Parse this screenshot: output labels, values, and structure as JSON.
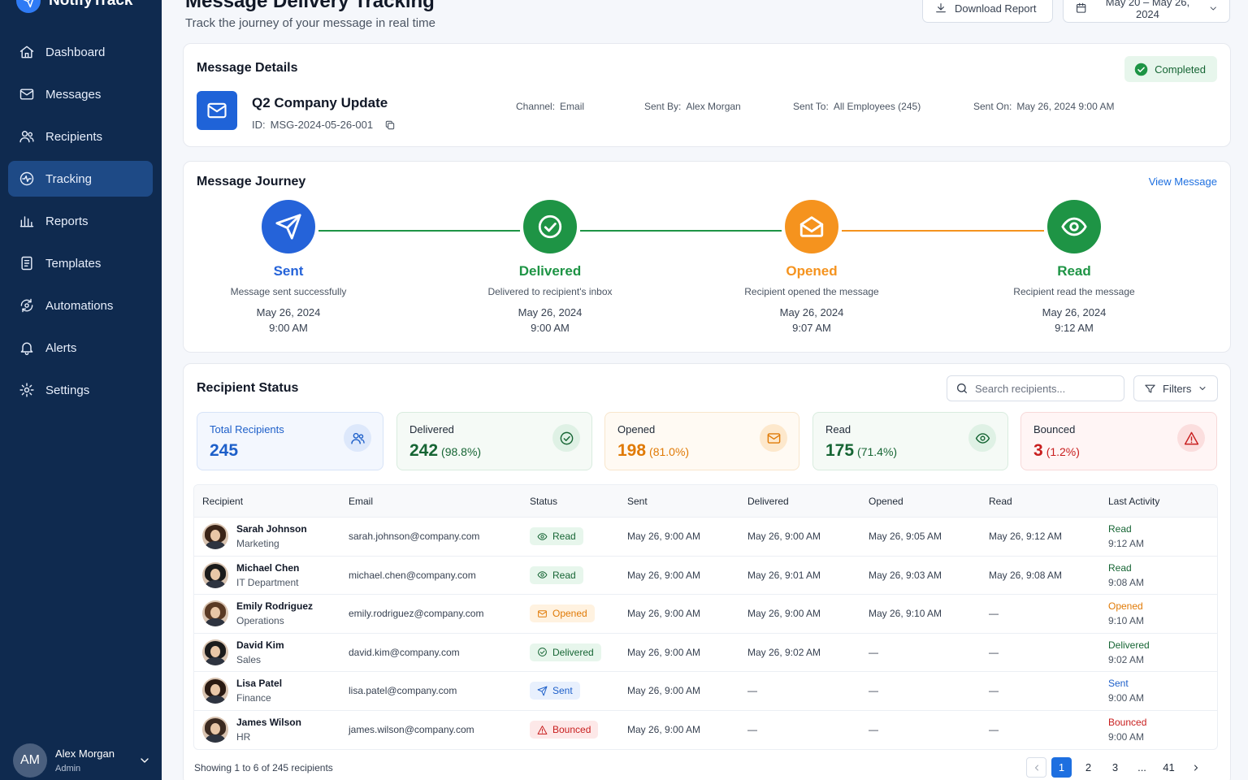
{
  "app": {
    "name": "NotifyTrack"
  },
  "nav": [
    {
      "label": "Dashboard",
      "icon": "home-icon"
    },
    {
      "label": "Messages",
      "icon": "mail-icon"
    },
    {
      "label": "Recipients",
      "icon": "users-icon"
    },
    {
      "label": "Tracking",
      "icon": "activity-icon",
      "active": true
    },
    {
      "label": "Reports",
      "icon": "bar-chart-icon"
    },
    {
      "label": "Templates",
      "icon": "document-icon"
    },
    {
      "label": "Automations",
      "icon": "automation-icon"
    },
    {
      "label": "Alerts",
      "icon": "bell-icon"
    },
    {
      "label": "Settings",
      "icon": "gear-icon"
    }
  ],
  "user": {
    "initials": "AM",
    "name": "Alex Morgan",
    "role": "Admin"
  },
  "header": {
    "title": "Message Delivery Tracking",
    "subtitle": "Track the journey of your message in real time",
    "download_label": "Download Report",
    "date_range": "May 20 – May 26, 2024"
  },
  "details": {
    "title": "Message Details",
    "status": "Completed",
    "message_name": "Q2 Company Update",
    "id_label": "ID:",
    "id_value": "MSG-2024-05-26-001",
    "channel_label": "Channel:",
    "channel_value": "Email",
    "sent_by_label": "Sent By:",
    "sent_by_value": "Alex Morgan",
    "sent_to_label": "Sent To:",
    "sent_to_value": "All Employees (245)",
    "sent_on_label": "Sent On:",
    "sent_on_value": "May 26, 2024 9:00 AM"
  },
  "journey": {
    "title": "Message Journey",
    "view_label": "View Message",
    "steps": [
      {
        "name": "Sent",
        "desc": "Message sent successfully",
        "date": "May 26, 2024",
        "time": "9:00 AM",
        "color": "#2563d9",
        "icon": "send-icon"
      },
      {
        "name": "Delivered",
        "desc": "Delivered to recipient's inbox",
        "date": "May 26, 2024",
        "time": "9:00 AM",
        "color": "#1e9445",
        "icon": "check-circle-icon"
      },
      {
        "name": "Opened",
        "desc": "Recipient opened the message",
        "date": "May 26, 2024",
        "time": "9:07 AM",
        "color": "#f5931e",
        "icon": "mail-open-icon"
      },
      {
        "name": "Read",
        "desc": "Recipient read the message",
        "date": "May 26, 2024",
        "time": "9:12 AM",
        "color": "#1e9445",
        "icon": "eye-icon"
      }
    ],
    "connector_colors": [
      "#1e9445",
      "#1e9445",
      "#f5931e"
    ]
  },
  "status": {
    "title": "Recipient Status",
    "search_placeholder": "Search recipients...",
    "filters_label": "Filters",
    "stats": [
      {
        "label": "Total Recipients",
        "value": "245",
        "pct": "",
        "icon": "users-icon",
        "fg": "#1d5fc9",
        "bg": "#f3f7fe",
        "border": "#d7e3f7",
        "icbg": "#dde8fb"
      },
      {
        "label": "Delivered",
        "value": "242",
        "pct": "(98.8%)",
        "icon": "check-circle-icon",
        "fg": "#166534",
        "bg": "#f5faf6",
        "border": "#d9ecdf",
        "icbg": "#dff1e5"
      },
      {
        "label": "Opened",
        "value": "198",
        "pct": "(81.0%)",
        "icon": "mail-icon",
        "fg": "#e07a06",
        "bg": "#fffaf3",
        "border": "#f8e6cc",
        "icbg": "#fde8cc"
      },
      {
        "label": "Read",
        "value": "175",
        "pct": "(71.4%)",
        "icon": "eye-icon",
        "fg": "#166534",
        "bg": "#f5faf6",
        "border": "#d9ecdf",
        "icbg": "#dff1e5"
      },
      {
        "label": "Bounced",
        "value": "3",
        "pct": "(1.2%)",
        "icon": "alert-triangle-icon",
        "fg": "#c81e1e",
        "bg": "#fff5f5",
        "border": "#f7d9d9",
        "icbg": "#fbdede"
      }
    ],
    "columns": [
      "Recipient",
      "Email",
      "Status",
      "Sent",
      "Delivered",
      "Opened",
      "Read",
      "Last Activity"
    ],
    "rows": [
      {
        "name": "Sarah Johnson",
        "dept": "Marketing",
        "email": "sarah.johnson@company.com",
        "status": "Read",
        "sent": "May 26, 9:00 AM",
        "delivered": "May 26, 9:00 AM",
        "opened": "May 26, 9:05 AM",
        "read": "May 26, 9:12 AM",
        "last": "Read",
        "last_time": "9:12 AM",
        "hair": "#3a2418"
      },
      {
        "name": "Michael Chen",
        "dept": "IT Department",
        "email": "michael.chen@company.com",
        "status": "Read",
        "sent": "May 26, 9:00 AM",
        "delivered": "May 26, 9:01 AM",
        "opened": "May 26, 9:03 AM",
        "read": "May 26, 9:08 AM",
        "last": "Read",
        "last_time": "9:08 AM",
        "hair": "#1b1b1b"
      },
      {
        "name": "Emily Rodriguez",
        "dept": "Operations",
        "email": "emily.rodriguez@company.com",
        "status": "Opened",
        "sent": "May 26, 9:00 AM",
        "delivered": "May 26, 9:00 AM",
        "opened": "May 26, 9:10 AM",
        "read": "—",
        "last": "Opened",
        "last_time": "9:10 AM",
        "hair": "#5a3a24"
      },
      {
        "name": "David Kim",
        "dept": "Sales",
        "email": "david.kim@company.com",
        "status": "Delivered",
        "sent": "May 26, 9:00 AM",
        "delivered": "May 26, 9:02 AM",
        "opened": "—",
        "read": "—",
        "last": "Delivered",
        "last_time": "9:02 AM",
        "hair": "#1b1b1b"
      },
      {
        "name": "Lisa Patel",
        "dept": "Finance",
        "email": "lisa.patel@company.com",
        "status": "Sent",
        "sent": "May 26, 9:00 AM",
        "delivered": "—",
        "opened": "—",
        "read": "—",
        "last": "Sent",
        "last_time": "9:00 AM",
        "hair": "#2a1a12"
      },
      {
        "name": "James Wilson",
        "dept": "HR",
        "email": "james.wilson@company.com",
        "status": "Bounced",
        "sent": "May 26, 9:00 AM",
        "delivered": "—",
        "opened": "—",
        "read": "—",
        "last": "Bounced",
        "last_time": "9:00 AM",
        "hair": "#3b2a20"
      }
    ],
    "status_styles": {
      "Read": {
        "fg": "#166534",
        "bg": "#e7f6ec",
        "icon": "eye-icon"
      },
      "Opened": {
        "fg": "#e07a06",
        "bg": "#fff2e0",
        "icon": "mail-icon"
      },
      "Delivered": {
        "fg": "#166534",
        "bg": "#e7f6ec",
        "icon": "check-circle-icon"
      },
      "Sent": {
        "fg": "#1d5fc9",
        "bg": "#e8f0fd",
        "icon": "send-icon"
      },
      "Bounced": {
        "fg": "#c81e1e",
        "bg": "#fde8e8",
        "icon": "alert-triangle-icon"
      }
    }
  },
  "footer": {
    "showing": "Showing 1 to 6 of 245 recipients",
    "pages": [
      "1",
      "2",
      "3",
      "...",
      "41"
    ],
    "active_page": "1"
  }
}
